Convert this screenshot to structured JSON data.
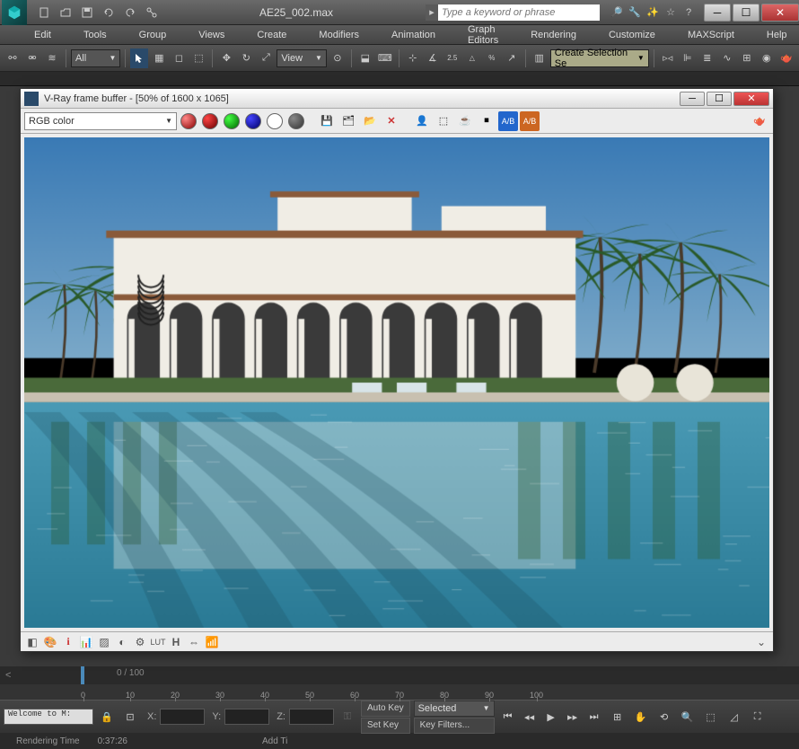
{
  "app": {
    "title": "AE25_002.max",
    "search_placeholder": "Type a keyword or phrase"
  },
  "menu": [
    "Edit",
    "Tools",
    "Group",
    "Views",
    "Create",
    "Modifiers",
    "Animation",
    "Graph Editors",
    "Rendering",
    "Customize",
    "MAXScript",
    "Help"
  ],
  "toolbar": {
    "filter": "All",
    "refspace": "View",
    "create_sel": "Create Selection Se"
  },
  "vfb": {
    "title": "V-Ray frame buffer - [50% of 1600 x 1065]",
    "channel": "RGB color"
  },
  "timeline": {
    "frame_label": "0 / 100",
    "ticks": [
      0,
      10,
      20,
      30,
      40,
      50,
      60,
      70,
      80,
      90,
      100
    ]
  },
  "status": {
    "welcome": "Welcome to M:",
    "lock_icon": "",
    "x": "X:",
    "y": "Y:",
    "z": "Z:",
    "autokey": "Auto Key",
    "setkey": "Set Key",
    "selected": "Selected",
    "keyfilters": "Key Filters...",
    "addtime": "Add Ti",
    "render_time_label": "Rendering Time",
    "render_time": "0:37:26"
  }
}
